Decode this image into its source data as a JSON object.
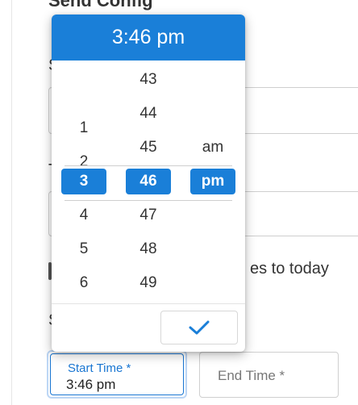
{
  "background": {
    "heading": "Send Config",
    "letters": [
      "S",
      "T",
      "S"
    ],
    "checkbox_text": "es to today"
  },
  "time_fields": {
    "start": {
      "label": "Start Time *",
      "value": "3:46 pm"
    },
    "end": {
      "placeholder": "End Time *"
    }
  },
  "picker": {
    "header_time": "3:46 pm",
    "hours": [
      "",
      "1",
      "2",
      "3",
      "4",
      "5",
      "6"
    ],
    "minutes": [
      "43",
      "44",
      "45",
      "46",
      "47",
      "48",
      "49"
    ],
    "meridiem": [
      "",
      "",
      "am",
      "pm",
      "",
      "",
      ""
    ],
    "selected": {
      "hour": "3",
      "minute": "46",
      "meridiem": "pm"
    },
    "confirm_icon": "check-icon",
    "accent_color": "#1a7fd8"
  }
}
